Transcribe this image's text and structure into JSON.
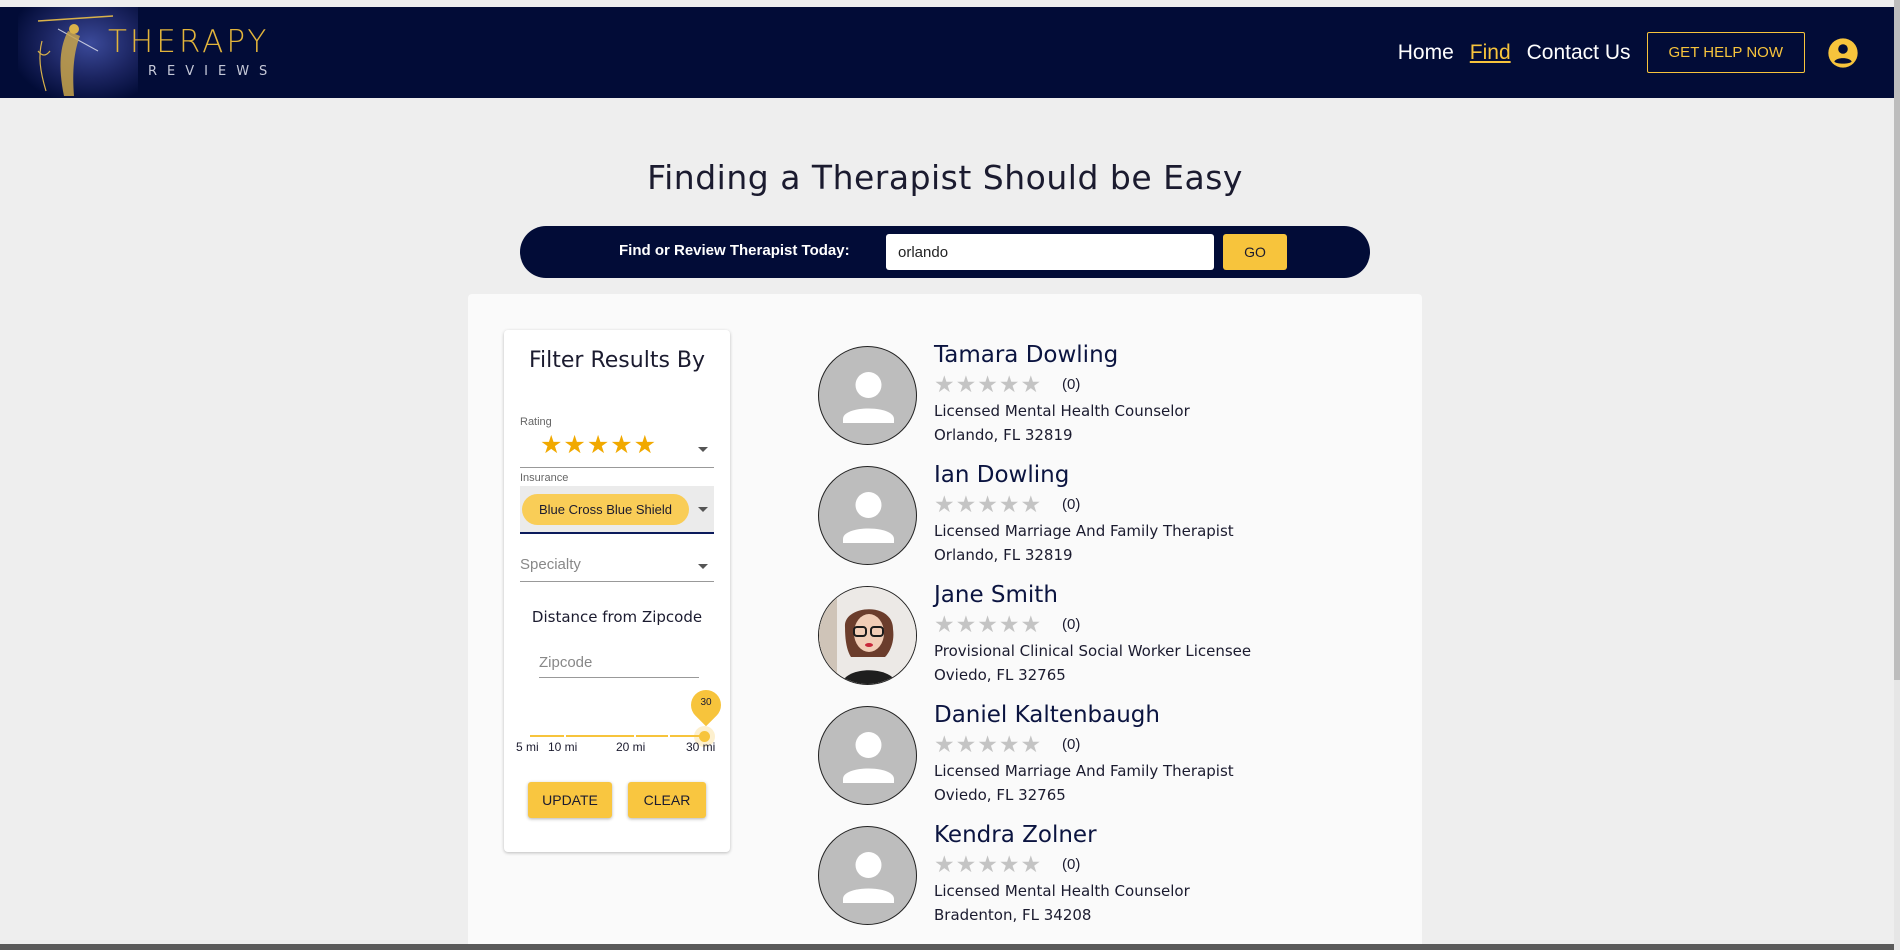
{
  "brand": {
    "title": "THERAPY",
    "subtitle": "REVIEWS"
  },
  "nav": {
    "links": [
      "Home",
      "Find",
      "Contact Us"
    ],
    "active": "Find",
    "help_button": "GET HELP NOW",
    "account_icon": "account-circle-icon"
  },
  "hero": {
    "title": "Finding a Therapist Should be Easy"
  },
  "search": {
    "label": "Find or Review Therapist Today:",
    "value": "orlando",
    "go_label": "GO"
  },
  "filter": {
    "title": "Filter Results By",
    "rating_label": "Rating",
    "rating_value": "★★★★★",
    "insurance_label": "Insurance",
    "insurance_chip": "Blue Cross Blue Shield",
    "specialty_placeholder": "Specialty",
    "distance_title": "Distance from Zipcode",
    "zipcode_placeholder": "Zipcode",
    "slider_value": "30",
    "ticks": [
      "5 mi",
      "10 mi",
      "20 mi",
      "30 mi"
    ],
    "update_label": "UPDATE",
    "clear_label": "CLEAR"
  },
  "results": [
    {
      "name": "Tamara Dowling",
      "stars": "★★★★★",
      "count": "(0)",
      "title": "Licensed Mental Health Counselor",
      "location": "Orlando, FL 32819",
      "avatar": "default-avatar"
    },
    {
      "name": "Ian Dowling",
      "stars": "★★★★★",
      "count": "(0)",
      "title": "Licensed Marriage And Family Therapist",
      "location": "Orlando, FL 32819",
      "avatar": "default-avatar"
    },
    {
      "name": "Jane Smith",
      "stars": "★★★★★",
      "count": "(0)",
      "title": "Provisional Clinical Social Worker Licensee",
      "location": "Oviedo, FL 32765",
      "avatar": "photo"
    },
    {
      "name": "Daniel Kaltenbaugh",
      "stars": "★★★★★",
      "count": "(0)",
      "title": "Licensed Marriage And Family Therapist",
      "location": "Oviedo, FL 32765",
      "avatar": "default-avatar"
    },
    {
      "name": "Kendra Zolner",
      "stars": "★★★★★",
      "count": "(0)",
      "title": "Licensed Mental Health Counselor",
      "location": "Bradenton, FL 34208",
      "avatar": "default-avatar"
    }
  ],
  "colors": {
    "navy": "#020c37",
    "accent": "#f7c43c",
    "star_filled": "#f1a900",
    "star_empty": "#c4c4c4"
  }
}
